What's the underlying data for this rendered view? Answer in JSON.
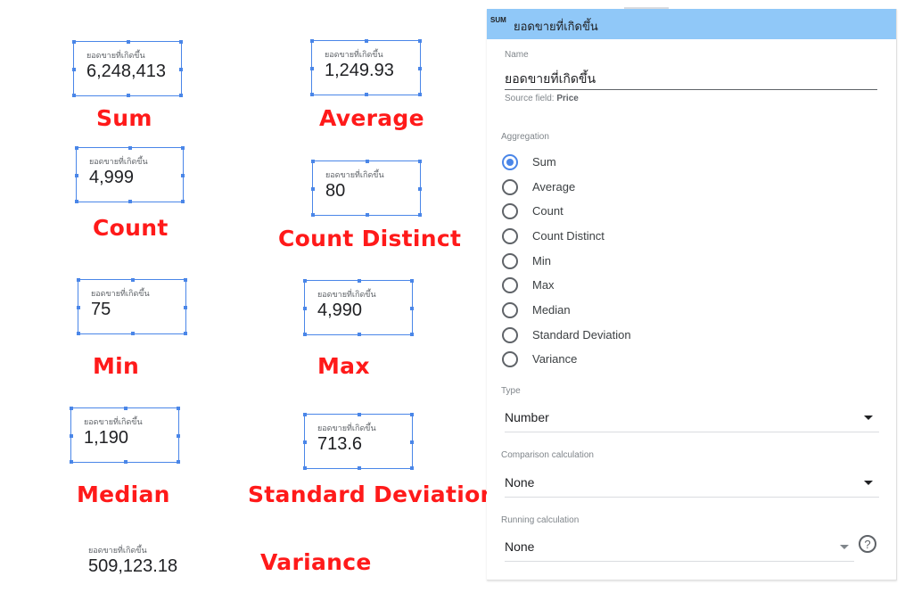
{
  "scorecards": [
    {
      "label": "ยอดขายที่เกิดขึ้น",
      "value": "6,248,413",
      "caption": "Sum"
    },
    {
      "label": "ยอดขายที่เกิดขึ้น",
      "value": "1,249.93",
      "caption": "Average"
    },
    {
      "label": "ยอดขายที่เกิดขึ้น",
      "value": "4,999",
      "caption": "Count"
    },
    {
      "label": "ยอดขายที่เกิดขึ้น",
      "value": "80",
      "caption": "Count Distinct"
    },
    {
      "label": "ยอดขายที่เกิดขึ้น",
      "value": "75",
      "caption": "Min"
    },
    {
      "label": "ยอดขายที่เกิดขึ้น",
      "value": "4,990",
      "caption": "Max"
    },
    {
      "label": "ยอดขายที่เกิดขึ้น",
      "value": "1,190",
      "caption": "Median"
    },
    {
      "label": "ยอดขายที่เกิดขึ้น",
      "value": "713.6",
      "caption": "Standard Deviation"
    },
    {
      "label": "ยอดขายที่เกิดขึ้น",
      "value": "509,123.18",
      "caption": "Variance"
    }
  ],
  "panel": {
    "tag": "SUM",
    "title": "ยอดขายที่เกิดขึ้น",
    "name_label": "Name",
    "name_value": "ยอดขายที่เกิดขึ้น",
    "source_prefix": "Source field:",
    "source_field": "Price",
    "aggregation_label": "Aggregation",
    "aggregation_options": [
      "Sum",
      "Average",
      "Count",
      "Count Distinct",
      "Min",
      "Max",
      "Median",
      "Standard Deviation",
      "Variance"
    ],
    "aggregation_selected": "Sum",
    "type_label": "Type",
    "type_value": "Number",
    "comparison_label": "Comparison calculation",
    "comparison_value": "None",
    "running_label": "Running calculation",
    "running_value": "None",
    "help_symbol": "?"
  },
  "colors": {
    "caption": "#ff1a1a",
    "header": "#90c8f8",
    "accent": "#4a86e8"
  }
}
